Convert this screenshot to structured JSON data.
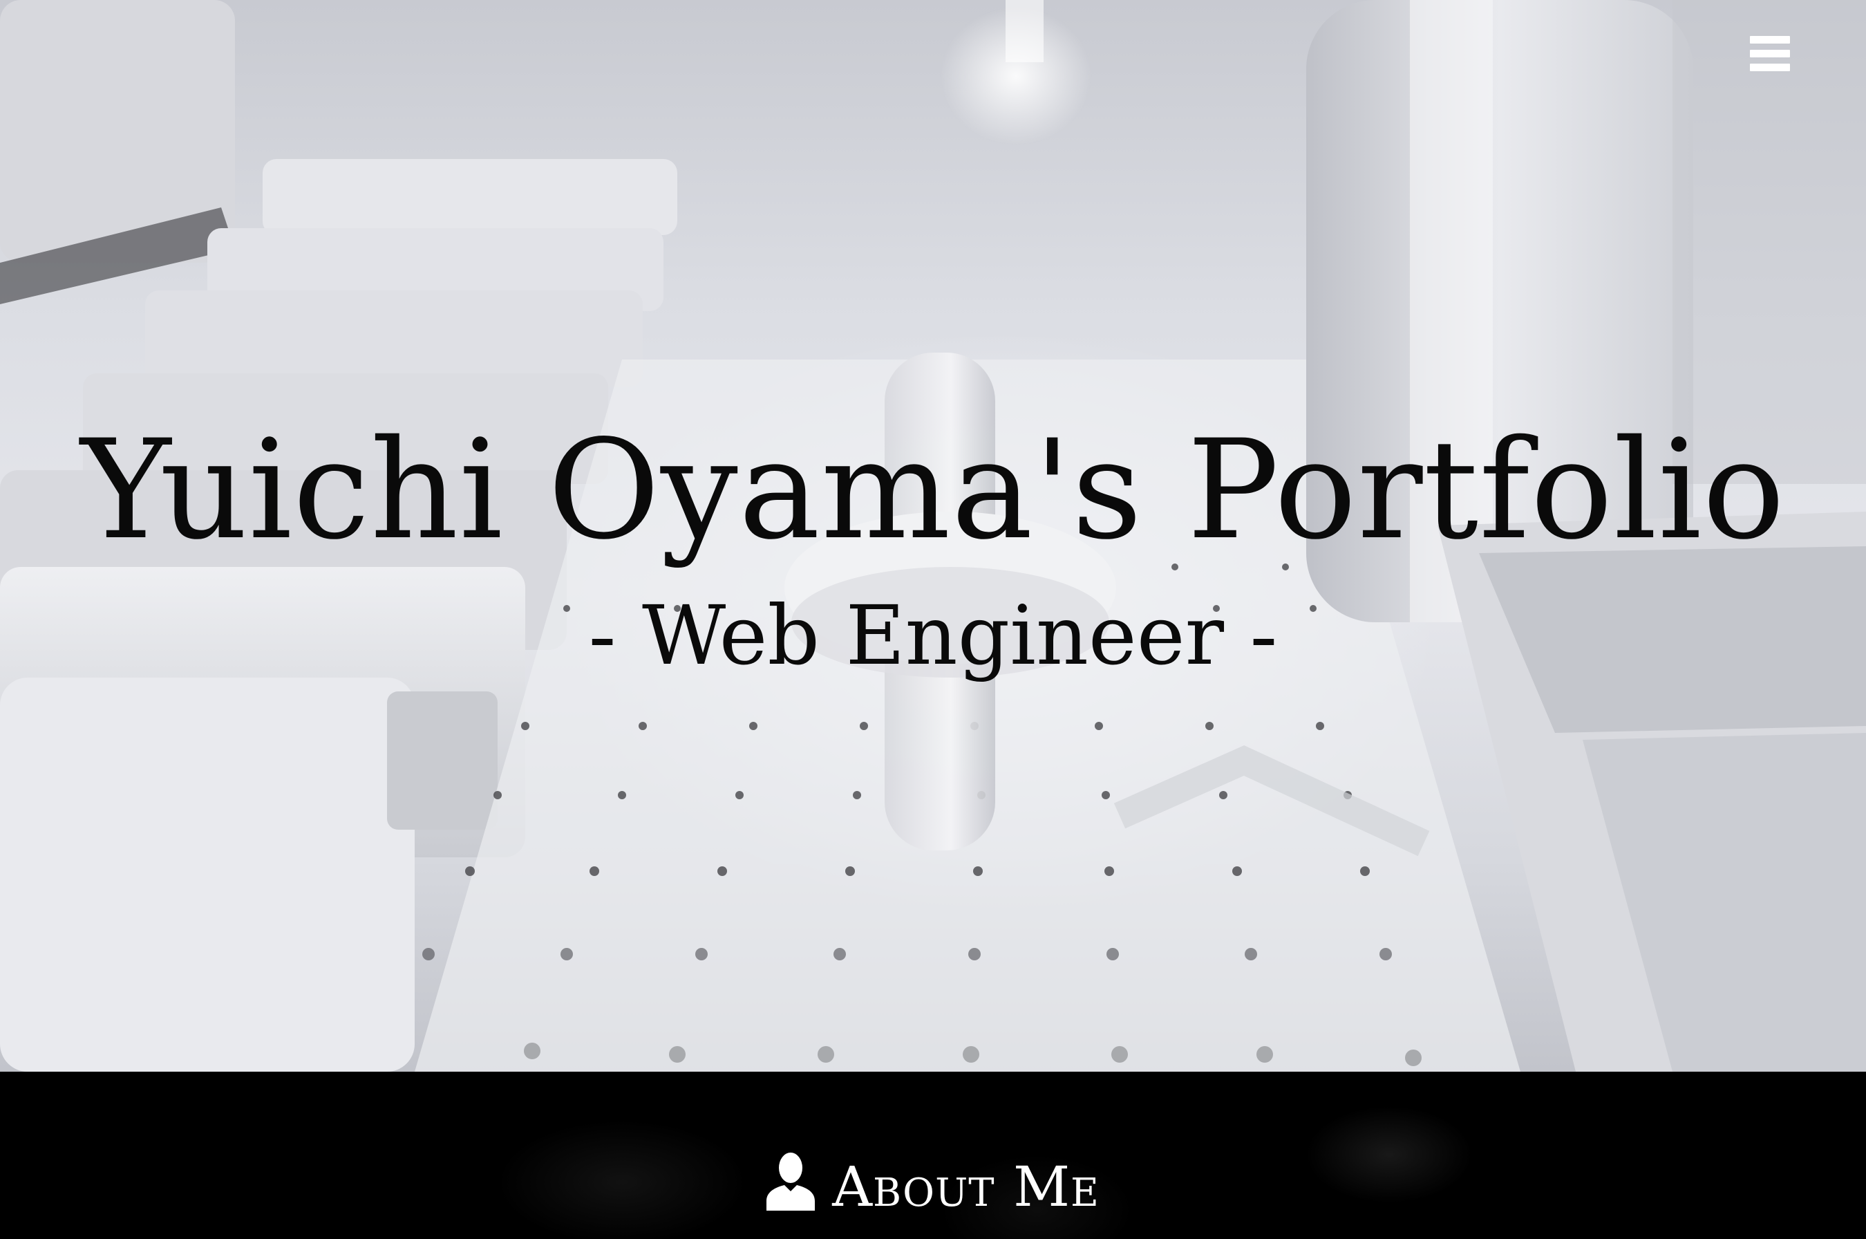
{
  "hero": {
    "title": "Yuichi Oyama's Portfolio",
    "subtitle": "- Web Engineer -"
  },
  "nav": {
    "menu_icon": "hamburger-menu-icon"
  },
  "about": {
    "icon": "person-icon",
    "heading": "About Me"
  },
  "colors": {
    "hero_text": "#0a0a0a",
    "section_background": "#000000",
    "section_text": "#ffffff",
    "menu_icon": "#ffffff"
  }
}
